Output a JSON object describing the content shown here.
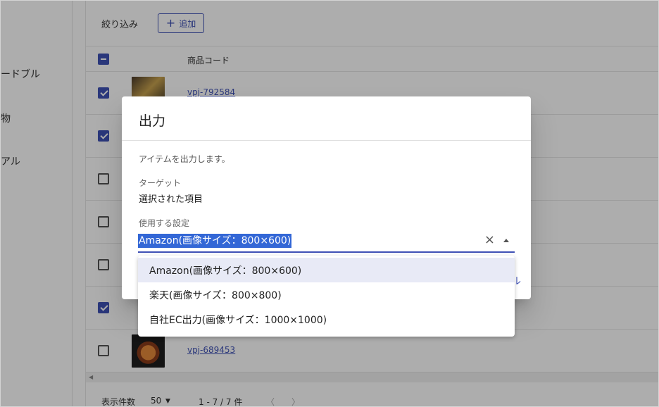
{
  "sidebar": {
    "items": [
      {
        "label": "ードブル"
      },
      {
        "label": "物"
      },
      {
        "label": "アル"
      }
    ]
  },
  "toolbar": {
    "filter_label": "絞り込み",
    "add_button": {
      "icon": "+",
      "label": "追加"
    }
  },
  "table": {
    "header": {
      "code_label": "商品コード"
    },
    "rows": [
      {
        "checked": true,
        "code": "vpj-792584"
      },
      {
        "checked": true,
        "code": ""
      },
      {
        "checked": false,
        "code": ""
      },
      {
        "checked": false,
        "code": ""
      },
      {
        "checked": false,
        "code": ""
      },
      {
        "checked": true,
        "code": ""
      },
      {
        "checked": false,
        "code": "vpj-689453"
      }
    ]
  },
  "footer": {
    "page_size_label": "表示件数",
    "page_size": "50",
    "range": "1 - 7 / 7 件",
    "prev": "〈",
    "next": "〉"
  },
  "dialog": {
    "title": "出力",
    "description": "アイテムを出力します。",
    "target_label": "ターゲット",
    "target_value": "選択された項目",
    "setting_label": "使用する設定",
    "setting_value": "Amazon(画像サイズ：800×600)",
    "clear_icon": "×",
    "action_peek": "ル"
  },
  "dropdown": {
    "options": [
      {
        "label": "Amazon(画像サイズ：800×600)",
        "active": true
      },
      {
        "label": "楽天(画像サイズ：800×800)",
        "active": false
      },
      {
        "label": "自社EC出力(画像サイズ：1000×1000)",
        "active": false
      }
    ]
  },
  "colors": {
    "accent": "#3f51b5",
    "selection": "#3367d6",
    "overlay": "rgba(0,0,0,0.32)"
  }
}
